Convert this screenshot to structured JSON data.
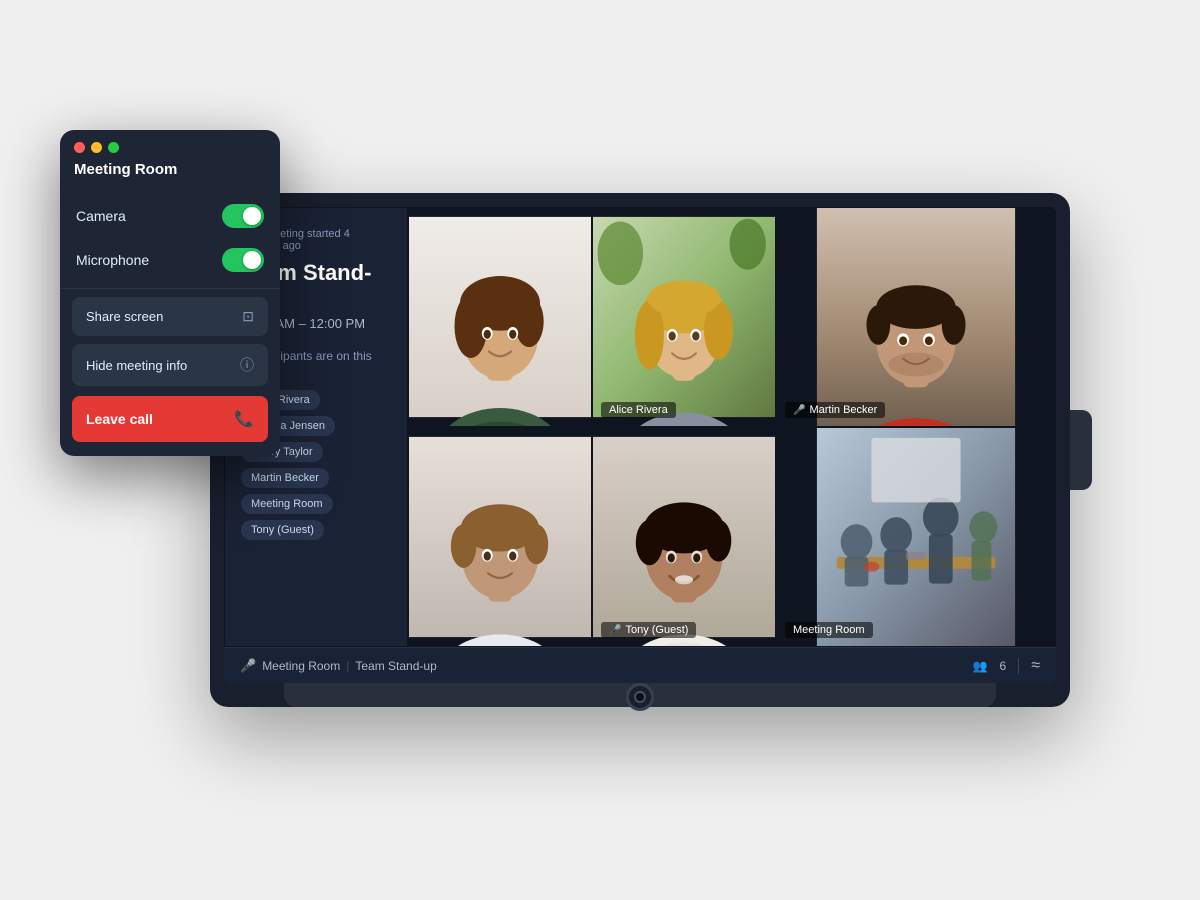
{
  "panel": {
    "title": "Meeting Room",
    "camera_label": "Camera",
    "microphone_label": "Microphone",
    "camera_on": true,
    "microphone_on": true,
    "share_screen_label": "Share screen",
    "hide_meeting_info_label": "Hide meeting info",
    "leave_call_label": "Leave call",
    "dots": [
      "red",
      "yellow",
      "green"
    ]
  },
  "meeting": {
    "started_text": "This meeting started 4 minutes ago",
    "title": "Team Stand-up",
    "time": "11:30 AM – 12:00 PM",
    "participants_label": "6 participants are on this call",
    "participants": [
      "Alice Rivera",
      "Andrea Jensen",
      "Henry Taylor",
      "Martin Becker",
      "Meeting Room",
      "Tony (Guest)"
    ]
  },
  "video_cells": [
    {
      "id": "cell-1",
      "label": null,
      "mic_off": false
    },
    {
      "id": "cell-2",
      "label": "Alice Rivera",
      "mic_off": false
    },
    {
      "id": "cell-3",
      "label": "Martin Becker",
      "mic_off": true
    },
    {
      "id": "cell-4",
      "label": null,
      "mic_off": false
    },
    {
      "id": "cell-5",
      "label": "Tony (Guest)",
      "mic_off": true
    },
    {
      "id": "cell-6",
      "label": "Meeting Room",
      "mic_off": false
    }
  ],
  "status_bar": {
    "mic_label": "Meeting Room",
    "meeting_name": "Team Stand-up",
    "participant_count": "6",
    "wave_icon": "≈"
  }
}
